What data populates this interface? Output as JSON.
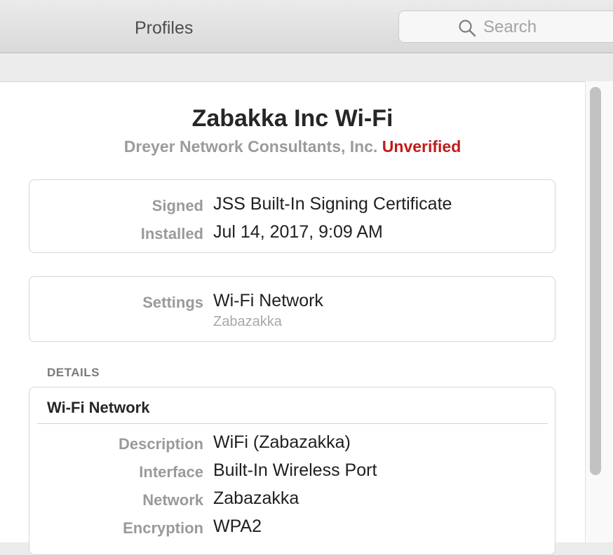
{
  "window": {
    "title": "Profiles"
  },
  "search": {
    "placeholder": "Search",
    "value": "",
    "icon": "search-icon"
  },
  "profile": {
    "title": "Zabakka Inc Wi-Fi",
    "organization": "Dreyer Network Consultants, Inc.",
    "verification_status": "Unverified",
    "verification_color": "#c01c1c"
  },
  "signature_card": {
    "rows": [
      {
        "label": "Signed",
        "value": "JSS Built-In Signing Certificate"
      },
      {
        "label": "Installed",
        "value": "Jul 14, 2017, 9:09 AM"
      }
    ]
  },
  "settings_card": {
    "label": "Settings",
    "value": "Wi-Fi Network",
    "subvalue": "Zabazakka"
  },
  "details": {
    "section_header": "DETAILS",
    "title": "Wi-Fi Network",
    "rows": [
      {
        "label": "Description",
        "value": "WiFi (Zabazakka)"
      },
      {
        "label": "Interface",
        "value": "Built-In Wireless Port"
      },
      {
        "label": "Network",
        "value": "Zabazakka"
      },
      {
        "label": "Encryption",
        "value": "WPA2"
      }
    ]
  }
}
